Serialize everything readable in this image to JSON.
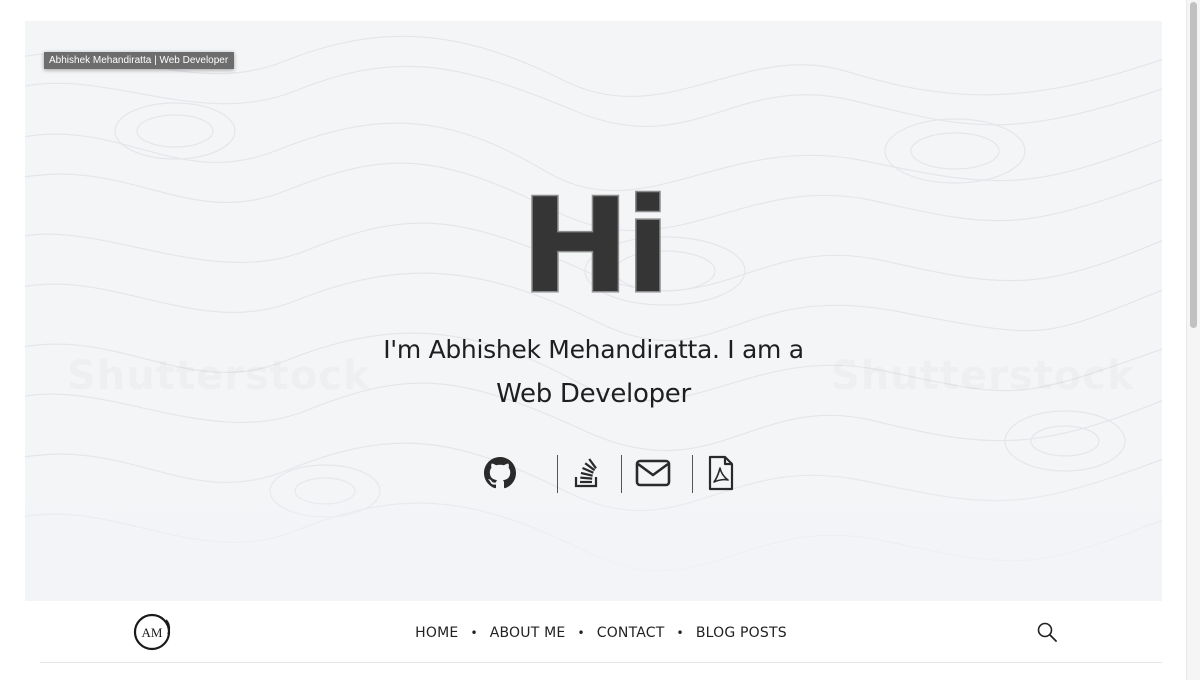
{
  "tooltip": "Abhishek Mehandiratta | Web Developer",
  "hero": {
    "greeting": "Hi",
    "intro": "I'm Abhishek Mehandiratta. I am a",
    "role": "Web Developer",
    "watermark": "Shutterstock"
  },
  "social": [
    {
      "icon": "github-icon"
    },
    {
      "icon": "stack-overflow-icon"
    },
    {
      "icon": "envelope-icon"
    },
    {
      "icon": "pdf-file-icon"
    }
  ],
  "logo": {
    "text": "AM"
  },
  "nav": {
    "items": [
      "HOME",
      "ABOUT ME",
      "CONTACT",
      "BLOG POSTS"
    ],
    "separator": "•"
  },
  "colors": {
    "hero_bg": "#f4f5f7",
    "heading": "#353535",
    "text": "#1f1f1f"
  }
}
